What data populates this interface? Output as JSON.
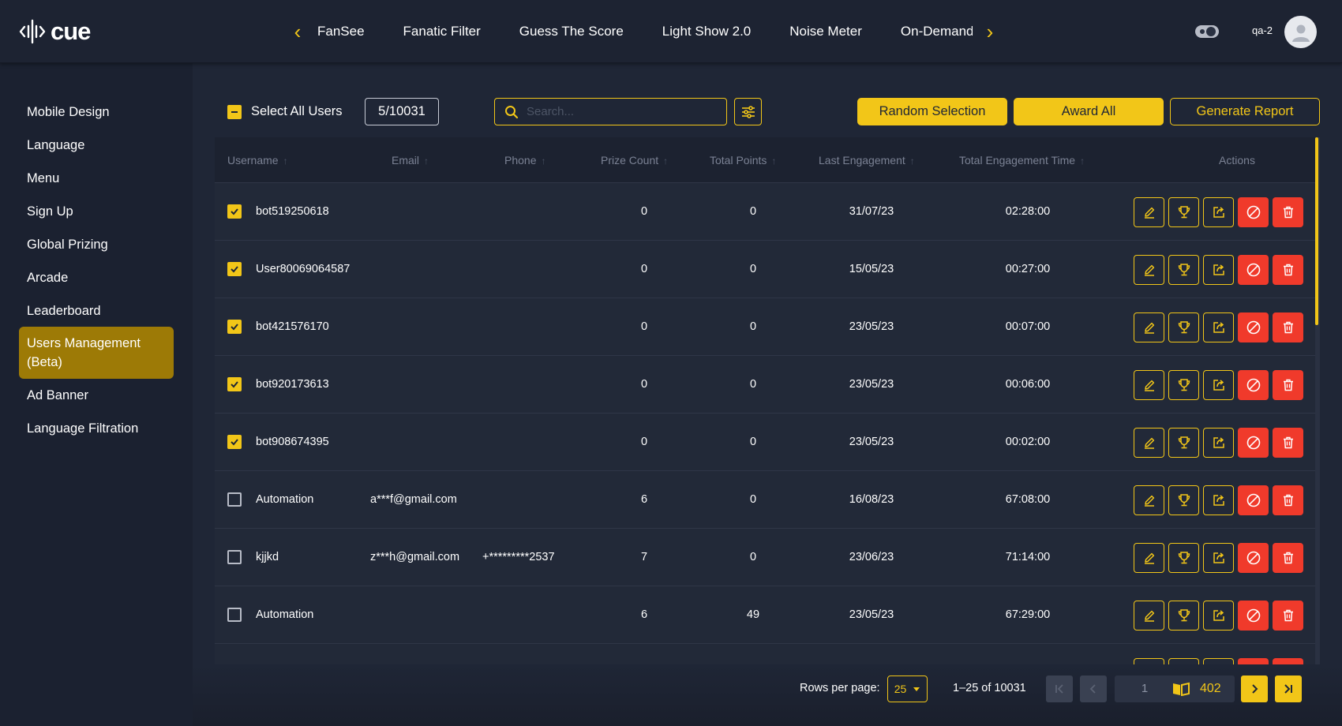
{
  "brand": {
    "logo_text": "cue"
  },
  "topnav": {
    "tabs": [
      "FanSee",
      "Fanatic Filter",
      "Guess The Score",
      "Light Show 2.0",
      "Noise Meter",
      "On-Demand"
    ],
    "user_name": "qa-2"
  },
  "sidebar": {
    "items": [
      {
        "label": "Mobile Design"
      },
      {
        "label": "Language"
      },
      {
        "label": "Menu"
      },
      {
        "label": "Sign Up"
      },
      {
        "label": "Global Prizing"
      },
      {
        "label": "Arcade"
      },
      {
        "label": "Leaderboard"
      },
      {
        "label": "Users Management (Beta)",
        "active": true
      },
      {
        "label": "Ad Banner"
      },
      {
        "label": "Language Filtration"
      }
    ]
  },
  "toolbar": {
    "select_all_label": "Select All Users",
    "selected_count": "5/10031",
    "search_placeholder": "Search...",
    "random_label": "Random Selection",
    "award_label": "Award All",
    "report_label": "Generate Report"
  },
  "table": {
    "columns": [
      "Username",
      "Email",
      "Phone",
      "Prize Count",
      "Total Points",
      "Last Engagement",
      "Total Engagement Time",
      "Actions"
    ],
    "rows": [
      {
        "checked": true,
        "username": "bot519250618",
        "email": "",
        "phone": "",
        "prize": "0",
        "points": "0",
        "last": "31/07/23",
        "time": "02:28:00"
      },
      {
        "checked": true,
        "username": "User80069064587",
        "email": "",
        "phone": "",
        "prize": "0",
        "points": "0",
        "last": "15/05/23",
        "time": "00:27:00"
      },
      {
        "checked": true,
        "username": "bot421576170",
        "email": "",
        "phone": "",
        "prize": "0",
        "points": "0",
        "last": "23/05/23",
        "time": "00:07:00"
      },
      {
        "checked": true,
        "username": "bot920173613",
        "email": "",
        "phone": "",
        "prize": "0",
        "points": "0",
        "last": "23/05/23",
        "time": "00:06:00"
      },
      {
        "checked": true,
        "username": "bot908674395",
        "email": "",
        "phone": "",
        "prize": "0",
        "points": "0",
        "last": "23/05/23",
        "time": "00:02:00"
      },
      {
        "checked": false,
        "username": "Automation",
        "email": "a***f@gmail.com",
        "phone": "",
        "prize": "6",
        "points": "0",
        "last": "16/08/23",
        "time": "67:08:00"
      },
      {
        "checked": false,
        "username": "kjjkd",
        "email": "z***h@gmail.com",
        "phone": "+*********2537",
        "prize": "7",
        "points": "0",
        "last": "23/06/23",
        "time": "71:14:00"
      },
      {
        "checked": false,
        "username": "Automation",
        "email": "",
        "phone": "",
        "prize": "6",
        "points": "49",
        "last": "23/05/23",
        "time": "67:29:00"
      }
    ]
  },
  "pagination": {
    "rows_per_page_label": "Rows per page:",
    "rows_per_page": "25",
    "range": "1–25 of 10031",
    "current_page": "1",
    "total_pages": "402"
  },
  "colors": {
    "accent": "#f2c618",
    "danger": "#f03a2b",
    "bg": "#1f2636",
    "sidebar_active": "#9d7a06"
  }
}
